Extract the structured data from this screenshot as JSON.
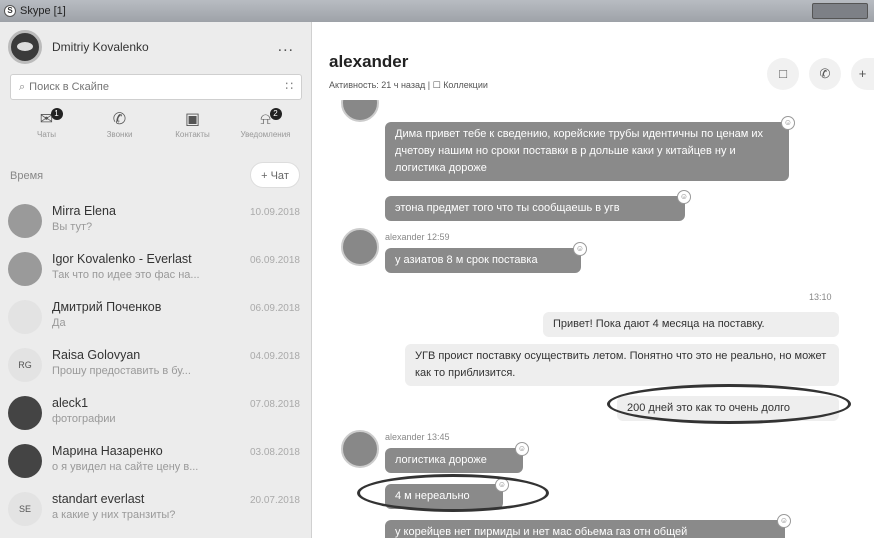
{
  "window": {
    "title": "Skype [1]"
  },
  "profile": {
    "name": "Dmitriy Kovalenko",
    "more": "..."
  },
  "search": {
    "placeholder": "Поиск в Скайпе"
  },
  "nav": [
    {
      "label": "Чаты",
      "icon": "chat-icon",
      "badge": "1"
    },
    {
      "label": "Звонки",
      "icon": "phone-icon"
    },
    {
      "label": "Контакты",
      "icon": "contacts-icon"
    },
    {
      "label": "Уведомления",
      "icon": "bell-icon",
      "badge": "2"
    }
  ],
  "list": {
    "sort_label": "Время",
    "new_chat_label": "+ Чат"
  },
  "contacts": [
    {
      "name": "Mirra Elena",
      "message": "Вы тут?",
      "date": "10.09.2018"
    },
    {
      "name": "Igor Kovalenko - Everlast",
      "message": "Так что по идее это фас на...",
      "date": "06.09.2018"
    },
    {
      "name": "Дмитрий Поченков",
      "message": "Да",
      "date": "06.09.2018"
    },
    {
      "name": "Raisa Golovyan",
      "message": "Прошу предоставить в бу...",
      "date": "04.09.2018",
      "initials": "RG"
    },
    {
      "name": "aleck1",
      "message": "фотографии",
      "date": "07.08.2018"
    },
    {
      "name": "Марина Назаренко",
      "message": "о я увидел на сайте цену в...",
      "date": "03.08.2018"
    },
    {
      "name": "standart everlast",
      "message": "а какие у них транзиты?",
      "date": "20.07.2018",
      "initials": "SE"
    }
  ],
  "chat_header": {
    "name": "alexander",
    "activity": "Активность: 21 ч назад",
    "separator": "|",
    "collections": "Коллекции"
  },
  "messages": {
    "m1": "Дима привет тебе к сведению, корейские трубы идентичны по ценам их дчетову нашим но сроки поставки в р дольше каки у китайцев ну и логистика дороже",
    "m2": "этона предмет того что ты сообщаешь в угв",
    "meta1": "alexander 12:59",
    "m3": "у азиатов 8 м срок поставка",
    "time_out": "13:10",
    "o1": "Привет! Пока дают 4 месяца на поставку.",
    "o2": "УГВ проист поставку осуществить летом. Понятно что это не реально, но может как то приблизится.",
    "o3": "200 дней это как то очень долго",
    "meta2": "alexander 13:45",
    "m4": "логистика дороже",
    "m5": "4 м нереально",
    "m6": "у корейцев нет пирмиды и нет мас обьема газ отн общей"
  }
}
